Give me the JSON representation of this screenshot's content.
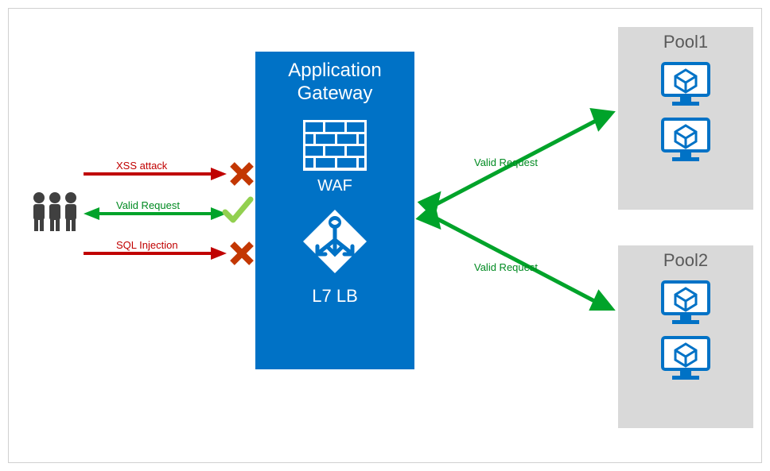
{
  "gateway": {
    "title_line1": "Application",
    "title_line2": "Gateway",
    "waf_label": "WAF",
    "l7lb_label": "L7 LB"
  },
  "pools": {
    "pool1_title": "Pool1",
    "pool2_title": "Pool2"
  },
  "labels": {
    "xss_attack": "XSS attack",
    "valid_request_left": "Valid Request",
    "sql_injection": "SQL Injection",
    "valid_request_top": "Valid Request",
    "valid_request_bottom": "Valid Request"
  },
  "colors": {
    "azure_blue": "#0072C6",
    "red": "#C00000",
    "green": "#00A32A",
    "grey_box": "#d9d9d9",
    "grey_text": "#595959"
  }
}
